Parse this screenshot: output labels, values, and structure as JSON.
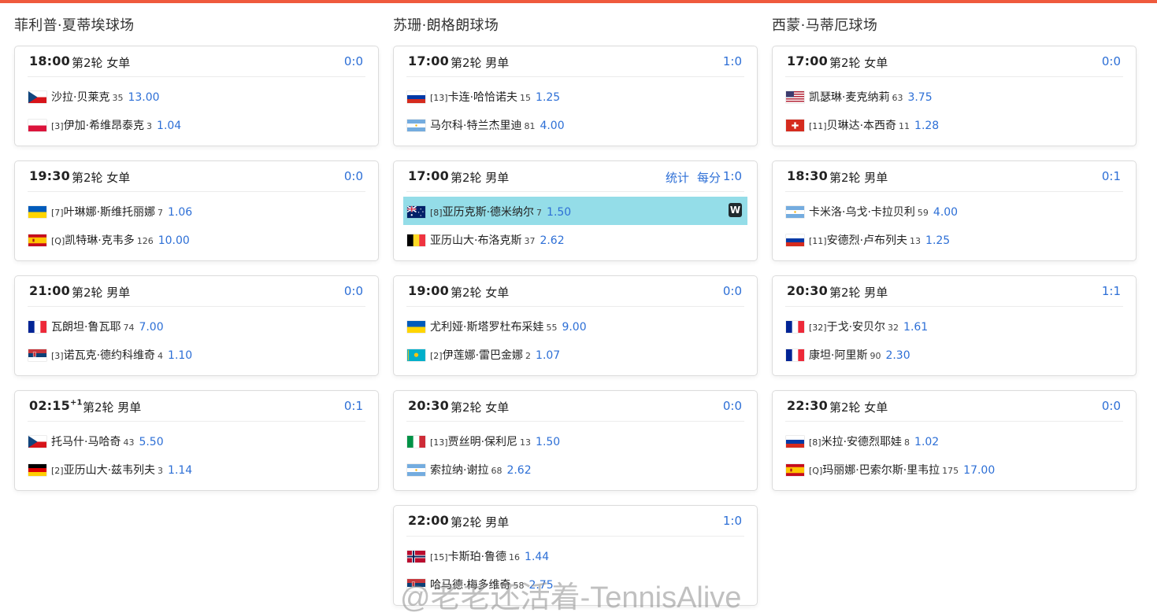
{
  "watermark": "@老老还活着-TennisAlive",
  "courts": [
    {
      "name": "菲利普·夏蒂埃球场",
      "matches": [
        {
          "time": "18:00",
          "time_sup": "",
          "round": "第2轮 女单",
          "score": "0:0",
          "links": [],
          "players": [
            {
              "flag": "cz",
              "seed": "",
              "name": "沙拉·贝莱克",
              "rank": "35",
              "odds": "13.00",
              "winner": false
            },
            {
              "flag": "pl",
              "seed": "[3]",
              "name": "伊加·希维昂泰克",
              "rank": "3",
              "odds": "1.04",
              "winner": false
            }
          ]
        },
        {
          "time": "19:30",
          "time_sup": "",
          "round": "第2轮 女单",
          "score": "0:0",
          "links": [],
          "players": [
            {
              "flag": "ua",
              "seed": "[7]",
              "name": "叶琳娜·斯维托丽娜",
              "rank": "7",
              "odds": "1.06",
              "winner": false
            },
            {
              "flag": "es",
              "seed": "[Q]",
              "name": "凯特琳·克韦多",
              "rank": "126",
              "odds": "10.00",
              "winner": false
            }
          ]
        },
        {
          "time": "21:00",
          "time_sup": "",
          "round": "第2轮 男单",
          "score": "0:0",
          "links": [],
          "players": [
            {
              "flag": "fr",
              "seed": "",
              "name": "瓦朗坦·鲁瓦耶",
              "rank": "74",
              "odds": "7.00",
              "winner": false
            },
            {
              "flag": "rs",
              "seed": "[3]",
              "name": "诺瓦克·德约科维奇",
              "rank": "4",
              "odds": "1.10",
              "winner": false
            }
          ]
        },
        {
          "time": "02:15",
          "time_sup": "+1",
          "round": "第2轮 男单",
          "score": "0:1",
          "links": [],
          "players": [
            {
              "flag": "cz",
              "seed": "",
              "name": "托马什·马哈奇",
              "rank": "43",
              "odds": "5.50",
              "winner": false
            },
            {
              "flag": "de",
              "seed": "[2]",
              "name": "亚历山大·兹韦列夫",
              "rank": "3",
              "odds": "1.14",
              "winner": false
            }
          ]
        }
      ]
    },
    {
      "name": "苏珊·朗格朗球场",
      "matches": [
        {
          "time": "17:00",
          "time_sup": "",
          "round": "第2轮 男单",
          "score": "1:0",
          "links": [],
          "players": [
            {
              "flag": "ru",
              "seed": "[13]",
              "name": "卡连·哈恰诺夫",
              "rank": "15",
              "odds": "1.25",
              "winner": false
            },
            {
              "flag": "ar",
              "seed": "",
              "name": "马尔科·特兰杰里迪",
              "rank": "81",
              "odds": "4.00",
              "winner": false
            }
          ]
        },
        {
          "time": "17:00",
          "time_sup": "",
          "round": "第2轮 男单",
          "score": "1:0",
          "links": [
            "统计",
            "每分"
          ],
          "players": [
            {
              "flag": "au",
              "seed": "[8]",
              "name": "亚历克斯·德米纳尔",
              "rank": "7",
              "odds": "1.50",
              "winner": true
            },
            {
              "flag": "be",
              "seed": "",
              "name": "亚历山大·布洛克斯",
              "rank": "37",
              "odds": "2.62",
              "winner": false
            }
          ]
        },
        {
          "time": "19:00",
          "time_sup": "",
          "round": "第2轮 女单",
          "score": "0:0",
          "links": [],
          "players": [
            {
              "flag": "ua",
              "seed": "",
              "name": "尤利娅·斯塔罗杜布采娃",
              "rank": "55",
              "odds": "9.00",
              "winner": false
            },
            {
              "flag": "kz",
              "seed": "[2]",
              "name": "伊莲娜·雷巴金娜",
              "rank": "2",
              "odds": "1.07",
              "winner": false
            }
          ]
        },
        {
          "time": "20:30",
          "time_sup": "",
          "round": "第2轮 女单",
          "score": "0:0",
          "links": [],
          "players": [
            {
              "flag": "it",
              "seed": "[13]",
              "name": "贾丝明·保利尼",
              "rank": "13",
              "odds": "1.50",
              "winner": false
            },
            {
              "flag": "ar",
              "seed": "",
              "name": "索拉纳·谢拉",
              "rank": "68",
              "odds": "2.62",
              "winner": false
            }
          ]
        },
        {
          "time": "22:00",
          "time_sup": "",
          "round": "第2轮 男单",
          "score": "1:0",
          "links": [],
          "players": [
            {
              "flag": "no",
              "seed": "[15]",
              "name": "卡斯珀·鲁德",
              "rank": "16",
              "odds": "1.44",
              "winner": false
            },
            {
              "flag": "rs",
              "seed": "",
              "name": "哈马德·梅多维奇",
              "rank": "58",
              "odds": "2.75",
              "winner": false
            }
          ]
        }
      ]
    },
    {
      "name": "西蒙·马蒂厄球场",
      "matches": [
        {
          "time": "17:00",
          "time_sup": "",
          "round": "第2轮 女单",
          "score": "0:0",
          "links": [],
          "players": [
            {
              "flag": "us",
              "seed": "",
              "name": "凯瑟琳·麦克纳莉",
              "rank": "63",
              "odds": "3.75",
              "winner": false
            },
            {
              "flag": "ch",
              "seed": "[11]",
              "name": "贝琳达·本西奇",
              "rank": "11",
              "odds": "1.28",
              "winner": false
            }
          ]
        },
        {
          "time": "18:30",
          "time_sup": "",
          "round": "第2轮 男单",
          "score": "0:1",
          "links": [],
          "players": [
            {
              "flag": "ar",
              "seed": "",
              "name": "卡米洛·乌戈·卡拉贝利",
              "rank": "59",
              "odds": "4.00",
              "winner": false
            },
            {
              "flag": "ru",
              "seed": "[11]",
              "name": "安德烈·卢布列夫",
              "rank": "13",
              "odds": "1.25",
              "winner": false
            }
          ]
        },
        {
          "time": "20:30",
          "time_sup": "",
          "round": "第2轮 男单",
          "score": "1:1",
          "links": [],
          "players": [
            {
              "flag": "fr",
              "seed": "[32]",
              "name": "于戈·安贝尔",
              "rank": "32",
              "odds": "1.61",
              "winner": false
            },
            {
              "flag": "fr",
              "seed": "",
              "name": "康坦·阿里斯",
              "rank": "90",
              "odds": "2.30",
              "winner": false
            }
          ]
        },
        {
          "time": "22:30",
          "time_sup": "",
          "round": "第2轮 女单",
          "score": "0:0",
          "links": [],
          "players": [
            {
              "flag": "ru",
              "seed": "[8]",
              "name": "米拉·安德烈耶娃",
              "rank": "8",
              "odds": "1.02",
              "winner": false
            },
            {
              "flag": "es",
              "seed": "[Q]",
              "name": "玛丽娜·巴索尔斯·里韦拉",
              "rank": "175",
              "odds": "17.00",
              "winner": false
            }
          ]
        }
      ]
    }
  ]
}
